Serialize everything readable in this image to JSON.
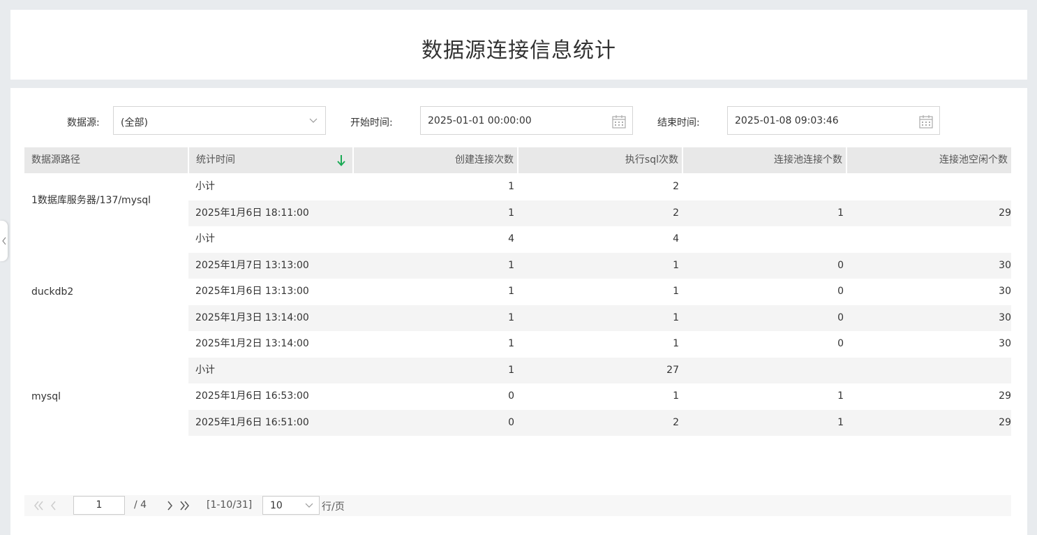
{
  "page": {
    "title": "数据源连接信息统计"
  },
  "filters": {
    "datasource_label": "数据源:",
    "datasource_value": "(全部)",
    "start_label": "开始时间:",
    "start_value": "2025-01-01 00:00:00",
    "end_label": "结束时间:",
    "end_value": "2025-01-08 09:03:46"
  },
  "table": {
    "columns": [
      "数据源路径",
      "统计时间",
      "创建连接次数",
      "执行sql次数",
      "连接池连接个数",
      "连接池空闲个数"
    ],
    "groups": [
      {
        "name": "1数据库服务器/137/mysql"
      },
      {
        "name": "duckdb2"
      },
      {
        "name": "mysql"
      }
    ],
    "rows": [
      {
        "time": "小计",
        "create": "1",
        "exec": "2",
        "pool": "",
        "idle": ""
      },
      {
        "time": "2025年1月6日 18:11:00",
        "create": "1",
        "exec": "2",
        "pool": "1",
        "idle": "29"
      },
      {
        "time": "小计",
        "create": "4",
        "exec": "4",
        "pool": "",
        "idle": ""
      },
      {
        "time": "2025年1月7日 13:13:00",
        "create": "1",
        "exec": "1",
        "pool": "0",
        "idle": "30"
      },
      {
        "time": "2025年1月6日 13:13:00",
        "create": "1",
        "exec": "1",
        "pool": "0",
        "idle": "30"
      },
      {
        "time": "2025年1月3日 13:14:00",
        "create": "1",
        "exec": "1",
        "pool": "0",
        "idle": "30"
      },
      {
        "time": "2025年1月2日 13:14:00",
        "create": "1",
        "exec": "1",
        "pool": "0",
        "idle": "30"
      },
      {
        "time": "小计",
        "create": "1",
        "exec": "27",
        "pool": "",
        "idle": ""
      },
      {
        "time": "2025年1月6日 16:53:00",
        "create": "0",
        "exec": "1",
        "pool": "1",
        "idle": "29"
      },
      {
        "time": "2025年1月6日 16:51:00",
        "create": "0",
        "exec": "2",
        "pool": "1",
        "idle": "29"
      }
    ]
  },
  "pager": {
    "current_page": "1",
    "total_pages": "/ 4",
    "range": "[1-10/31]",
    "page_size": "10",
    "per_page_label": "行/页"
  },
  "colors": {
    "sort_arrow": "#1aaa55",
    "header_bg": "#e8e8e8",
    "alt_row_bg": "#f4f4f4"
  },
  "icons": {
    "sort": "arrow-down-icon",
    "calendar": "calendar-icon",
    "dropdown": "chevron-down-icon"
  }
}
